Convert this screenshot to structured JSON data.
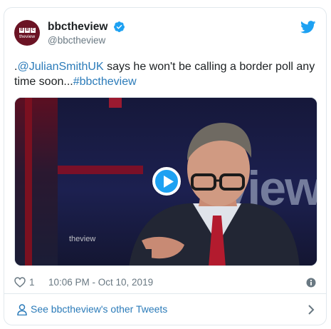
{
  "author": {
    "display_name": "bbctheview",
    "handle": "@bbctheview",
    "avatar_text": [
      "B",
      "B",
      "C"
    ],
    "avatar_sub": "theview"
  },
  "tweet": {
    "prefix": ".",
    "mention": "@JulianSmithUK",
    "body": " says he won't be calling a border poll any time soon...",
    "hashtag": "#bbctheview"
  },
  "media": {
    "background_word": "view",
    "watermark": "theview"
  },
  "meta": {
    "likes": "1",
    "timestamp": "10:06 PM - Oct 10, 2019"
  },
  "footer": {
    "link_text": "See bbctheview's other Tweets"
  },
  "icons": {
    "verified": "verified-badge-icon",
    "brand": "twitter-bird-icon",
    "like": "heart-icon",
    "info": "info-icon",
    "play": "play-icon",
    "user": "user-icon",
    "chevron": "chevron-right-icon"
  },
  "colors": {
    "link": "#2b7bb9",
    "twitter_blue": "#1da1f2",
    "secondary_text": "#697882",
    "avatar_bg": "#6b1324"
  }
}
